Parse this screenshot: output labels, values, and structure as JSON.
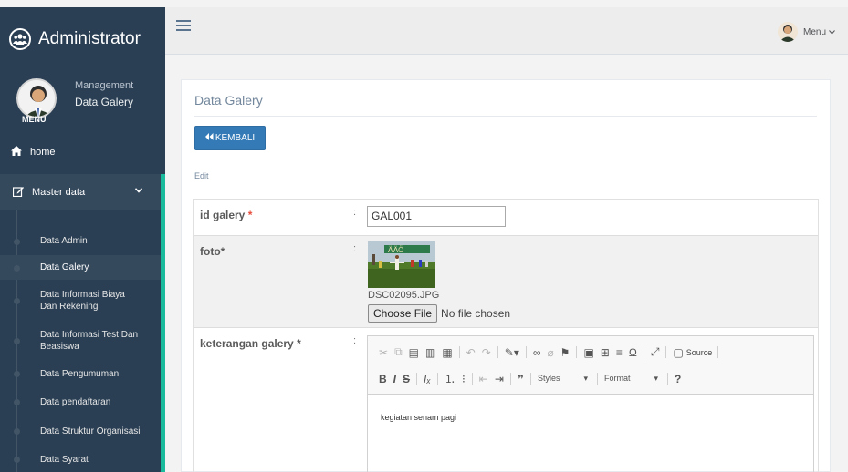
{
  "sidebar": {
    "brand": "Administrator",
    "profile": {
      "role": "Management",
      "name": "Data Galery",
      "menu_tag": "MENU"
    },
    "home_label": "home",
    "master_label": "Master data",
    "items": [
      "Data Admin",
      "Data Galery",
      "Data Informasi Biaya Dan Rekening",
      "Data Informasi Test Dan Beasiswa",
      "Data Pengumuman",
      "Data pendaftaran",
      "Data Struktur Organisasi",
      "Data Syarat"
    ],
    "active_item": "Data Galery"
  },
  "topbar": {
    "menu_label": "Menu"
  },
  "panel": {
    "title": "Data Galery",
    "back_button": "KEMBALI",
    "mode_label": "Edit"
  },
  "form": {
    "id_label": "id galery",
    "id_value": "GAL001",
    "foto_label": "foto*",
    "foto_filename": "DSC02095.JPG",
    "choose_file": "Choose File",
    "no_file": "No file chosen",
    "desc_label": "keterangan galery",
    "required_mark": "*",
    "colon": ":",
    "editor": {
      "source_label": "Source",
      "styles_label": "Styles",
      "format_label": "Format",
      "content": "kegiatan senam pagi"
    }
  },
  "colors": {
    "sidebar_bg": "#2a3f54",
    "accent": "#1abb9c",
    "primary_button": "#337ab7"
  }
}
